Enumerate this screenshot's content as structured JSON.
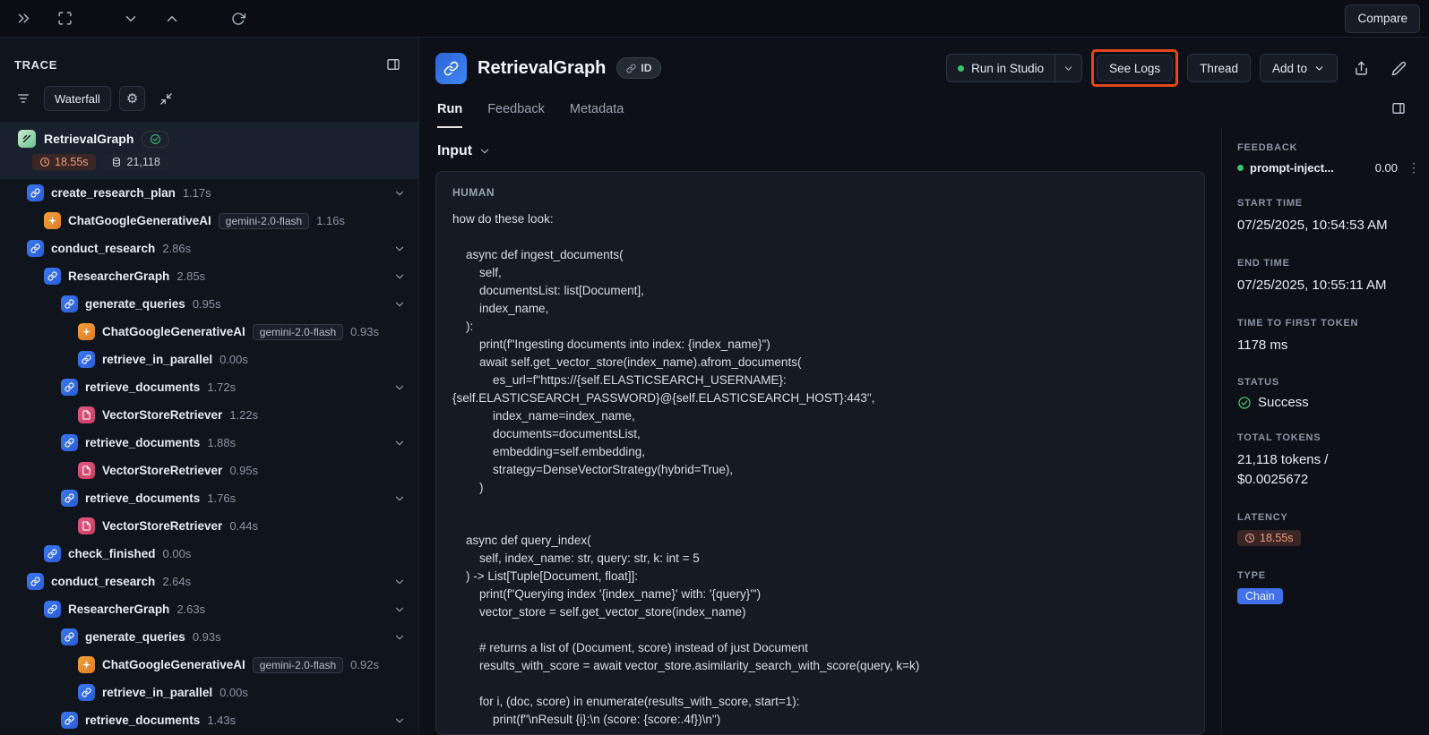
{
  "colors": {
    "accent_green": "#3fbf6f",
    "latency_badge_bg": "#3a2624",
    "latency_badge_text": "#ef9b80",
    "chain_badge_bg": "#4170e8",
    "annotation_highlight": "#e0481c"
  },
  "topbar": {
    "compare": "Compare"
  },
  "trace": {
    "title": "TRACE",
    "waterfall": "Waterfall",
    "root": {
      "name": "RetrievalGraph",
      "latency": "18.55s",
      "tokens": "21,118"
    },
    "tree": [
      {
        "indent": 0,
        "icon": "chain",
        "name": "create_research_plan",
        "duration": "1.17s",
        "chevron": true
      },
      {
        "indent": 1,
        "icon": "llm",
        "name": "ChatGoogleGenerativeAI",
        "model": "gemini-2.0-flash",
        "duration": "1.16s",
        "chevron": false
      },
      {
        "indent": 0,
        "icon": "chain",
        "name": "conduct_research",
        "duration": "2.86s",
        "chevron": true
      },
      {
        "indent": 1,
        "icon": "chain",
        "name": "ResearcherGraph",
        "duration": "2.85s",
        "chevron": true
      },
      {
        "indent": 2,
        "icon": "chain",
        "name": "generate_queries",
        "duration": "0.95s",
        "chevron": true
      },
      {
        "indent": 3,
        "icon": "llm",
        "name": "ChatGoogleGenerativeAI",
        "model": "gemini-2.0-flash",
        "duration": "0.93s",
        "chevron": false
      },
      {
        "indent": 3,
        "icon": "chain",
        "name": "retrieve_in_parallel",
        "duration": "0.00s",
        "chevron": false
      },
      {
        "indent": 2,
        "icon": "chain",
        "name": "retrieve_documents",
        "duration": "1.72s",
        "chevron": true
      },
      {
        "indent": 3,
        "icon": "retr",
        "name": "VectorStoreRetriever",
        "duration": "1.22s",
        "chevron": false
      },
      {
        "indent": 2,
        "icon": "chain",
        "name": "retrieve_documents",
        "duration": "1.88s",
        "chevron": true
      },
      {
        "indent": 3,
        "icon": "retr",
        "name": "VectorStoreRetriever",
        "duration": "0.95s",
        "chevron": false
      },
      {
        "indent": 2,
        "icon": "chain",
        "name": "retrieve_documents",
        "duration": "1.76s",
        "chevron": true
      },
      {
        "indent": 3,
        "icon": "retr",
        "name": "VectorStoreRetriever",
        "duration": "0.44s",
        "chevron": false
      },
      {
        "indent": 1,
        "icon": "chain",
        "name": "check_finished",
        "duration": "0.00s",
        "chevron": false
      },
      {
        "indent": 0,
        "icon": "chain",
        "name": "conduct_research",
        "duration": "2.64s",
        "chevron": true
      },
      {
        "indent": 1,
        "icon": "chain",
        "name": "ResearcherGraph",
        "duration": "2.63s",
        "chevron": true
      },
      {
        "indent": 2,
        "icon": "chain",
        "name": "generate_queries",
        "duration": "0.93s",
        "chevron": true
      },
      {
        "indent": 3,
        "icon": "llm",
        "name": "ChatGoogleGenerativeAI",
        "model": "gemini-2.0-flash",
        "duration": "0.92s",
        "chevron": false
      },
      {
        "indent": 3,
        "icon": "chain",
        "name": "retrieve_in_parallel",
        "duration": "0.00s",
        "chevron": false
      },
      {
        "indent": 2,
        "icon": "chain",
        "name": "retrieve_documents",
        "duration": "1.43s",
        "chevron": true
      }
    ]
  },
  "header": {
    "title": "RetrievalGraph",
    "id_chip": "ID",
    "run_in_studio": "Run in Studio",
    "see_logs": "See Logs",
    "thread": "Thread",
    "add_to": "Add to"
  },
  "tabs": [
    {
      "label": "Run",
      "active": true
    },
    {
      "label": "Feedback",
      "active": false
    },
    {
      "label": "Metadata",
      "active": false
    }
  ],
  "input": {
    "label": "Input",
    "role": "HUMAN",
    "text": "how do these look:\n\n    async def ingest_documents(\n        self,\n        documentsList: list[Document],\n        index_name,\n    ):\n        print(f\"Ingesting documents into index: {index_name}\")\n        await self.get_vector_store(index_name).afrom_documents(\n            es_url=f\"https://{self.ELASTICSEARCH_USERNAME}:{self.ELASTICSEARCH_PASSWORD}@{self.ELASTICSEARCH_HOST}:443\",\n            index_name=index_name,\n            documents=documentsList,\n            embedding=self.embedding,\n            strategy=DenseVectorStrategy(hybrid=True),\n        )\n\n\n    async def query_index(\n        self, index_name: str, query: str, k: int = 5\n    ) -> List[Tuple[Document, float]]:\n        print(f\"Querying index '{index_name}' with: '{query}'\")\n        vector_store = self.get_vector_store(index_name)\n\n        # returns a list of (Document, score) instead of just Document\n        results_with_score = await vector_store.asimilarity_search_with_score(query, k=k)\n\n        for i, (doc, score) in enumerate(results_with_score, start=1):\n            print(f\"\\nResult {i}:\\n (score: {score:.4f})\\n\")"
  },
  "details": {
    "feedback": {
      "label": "FEEDBACK",
      "name": "prompt-inject...",
      "score": "0.00"
    },
    "start_time": {
      "label": "START TIME",
      "value": "07/25/2025, 10:54:53 AM"
    },
    "end_time": {
      "label": "END TIME",
      "value": "07/25/2025, 10:55:11 AM"
    },
    "ttft": {
      "label": "TIME TO FIRST TOKEN",
      "value": "1178 ms"
    },
    "status": {
      "label": "STATUS",
      "value": "Success"
    },
    "total_tokens": {
      "label": "TOTAL TOKENS",
      "value": "21,118 tokens /\n$0.0025672"
    },
    "latency": {
      "label": "LATENCY",
      "value": "18.55s"
    },
    "type": {
      "label": "TYPE",
      "value": "Chain"
    }
  }
}
